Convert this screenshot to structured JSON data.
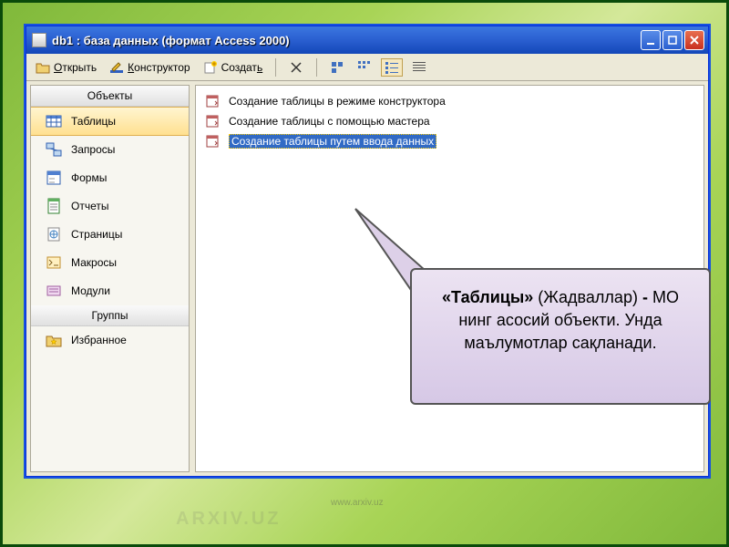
{
  "watermark": "ARXIV.UZ",
  "watermark_small": "www.arxiv.uz",
  "titlebar": {
    "title": "db1 : база данных (формат Access 2000)"
  },
  "toolbar": {
    "open": "Открыть",
    "design": "Конструктор",
    "create": "Создать"
  },
  "sidebar": {
    "header_objects": "Объекты",
    "header_groups": "Группы",
    "items": [
      {
        "label": "Таблицы"
      },
      {
        "label": "Запросы"
      },
      {
        "label": "Формы"
      },
      {
        "label": "Отчеты"
      },
      {
        "label": "Страницы"
      },
      {
        "label": "Макросы"
      },
      {
        "label": "Модули"
      }
    ],
    "favorites": "Избранное"
  },
  "list": {
    "items": [
      {
        "label": "Создание таблицы в режиме конструктора"
      },
      {
        "label": "Создание таблицы с помощью мастера"
      },
      {
        "label": "Создание таблицы путем ввода данных"
      }
    ]
  },
  "callout": {
    "bold": "«Таблицы»",
    "paren": " (Жадваллар) ",
    "bold2": "-",
    "rest": " МО нинг асосий объекти. Унда маълумотлар сақланади."
  }
}
